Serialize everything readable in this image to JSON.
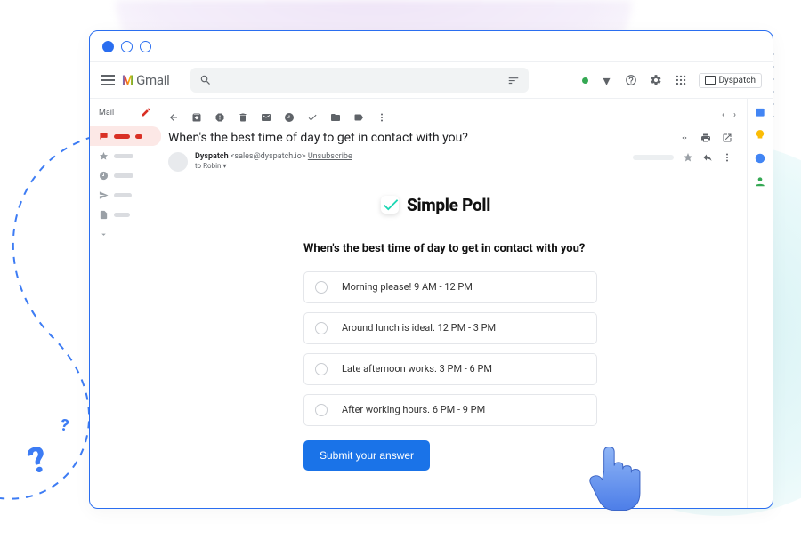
{
  "app": {
    "brand_m": "M",
    "brand_text": "Gmail",
    "addon_label": "Dyspatch",
    "sidebar_header": "Mail"
  },
  "email": {
    "subject": "When's the best time of day to get in contact with you?",
    "sender_name": "Dyspatch",
    "sender_email": "<sales@dyspatch.io>",
    "unsubscribe": "Unsubscribe",
    "to_prefix": "to Robin",
    "to_caret": "▾"
  },
  "poll": {
    "brand": "Simple Poll",
    "question": "When's the best time of day to get in contact with you?",
    "options": [
      "Morning please! 9 AM - 12 PM",
      "Around lunch is ideal. 12 PM - 3 PM",
      "Late afternoon works. 3 PM - 6 PM",
      "After working hours. 6 PM -  9 PM"
    ],
    "submit": "Submit your answer"
  }
}
